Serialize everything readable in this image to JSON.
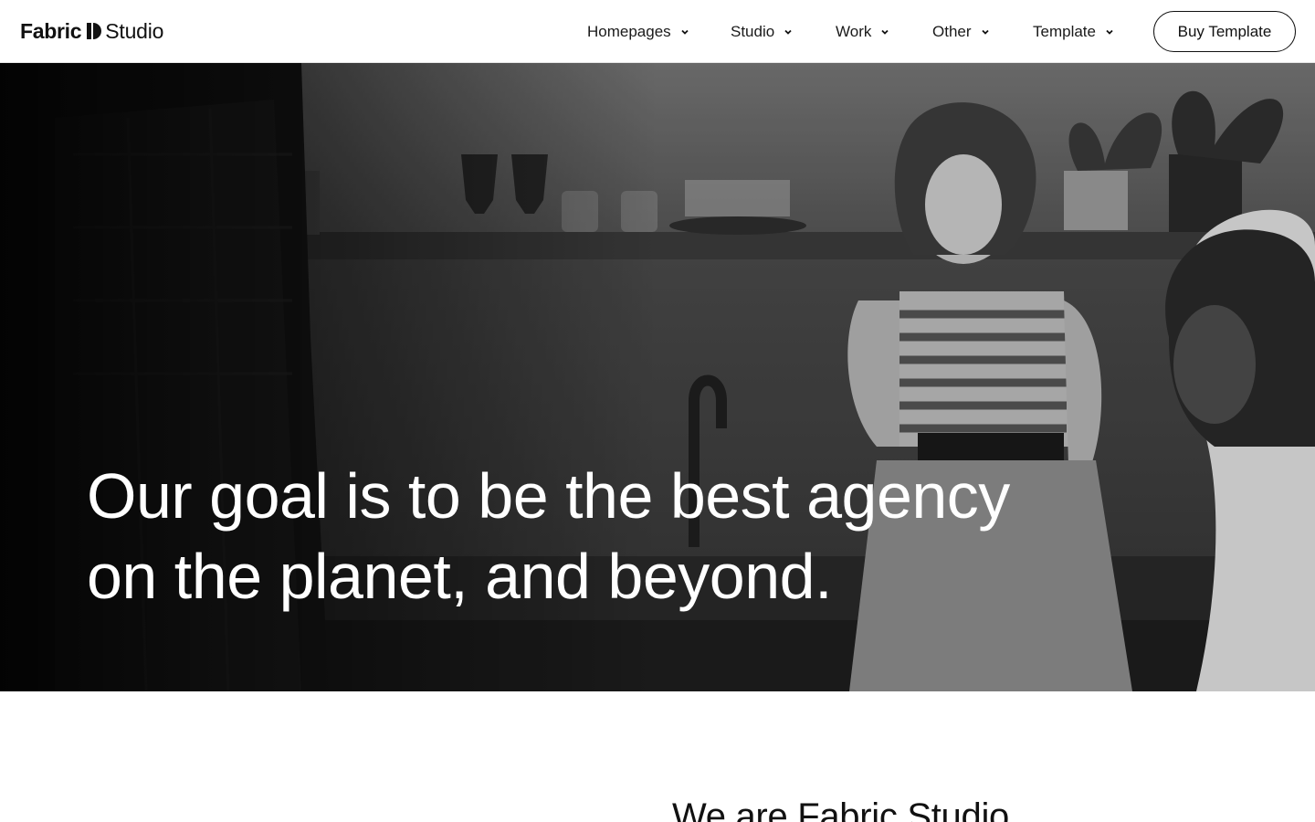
{
  "brand": {
    "name_bold": "Fabric",
    "name_light": "Studio",
    "logo_icon": "half-circle-logo-icon"
  },
  "nav": {
    "items": [
      {
        "label": "Homepages",
        "icon": "chevron-down-icon"
      },
      {
        "label": "Studio",
        "icon": "chevron-down-icon"
      },
      {
        "label": "Work",
        "icon": "chevron-down-icon"
      },
      {
        "label": "Other",
        "icon": "chevron-down-icon"
      },
      {
        "label": "Template",
        "icon": "chevron-down-icon"
      }
    ],
    "cta_label": "Buy Template"
  },
  "hero": {
    "title_line1": "Our goal is to be the best agency",
    "title_line2": "on the planet, and beyond.",
    "image_style": "grayscale"
  },
  "about": {
    "heading": "We are Fabric Studio"
  },
  "colors": {
    "text": "#111111",
    "background": "#ffffff",
    "hero_text": "#ffffff"
  }
}
